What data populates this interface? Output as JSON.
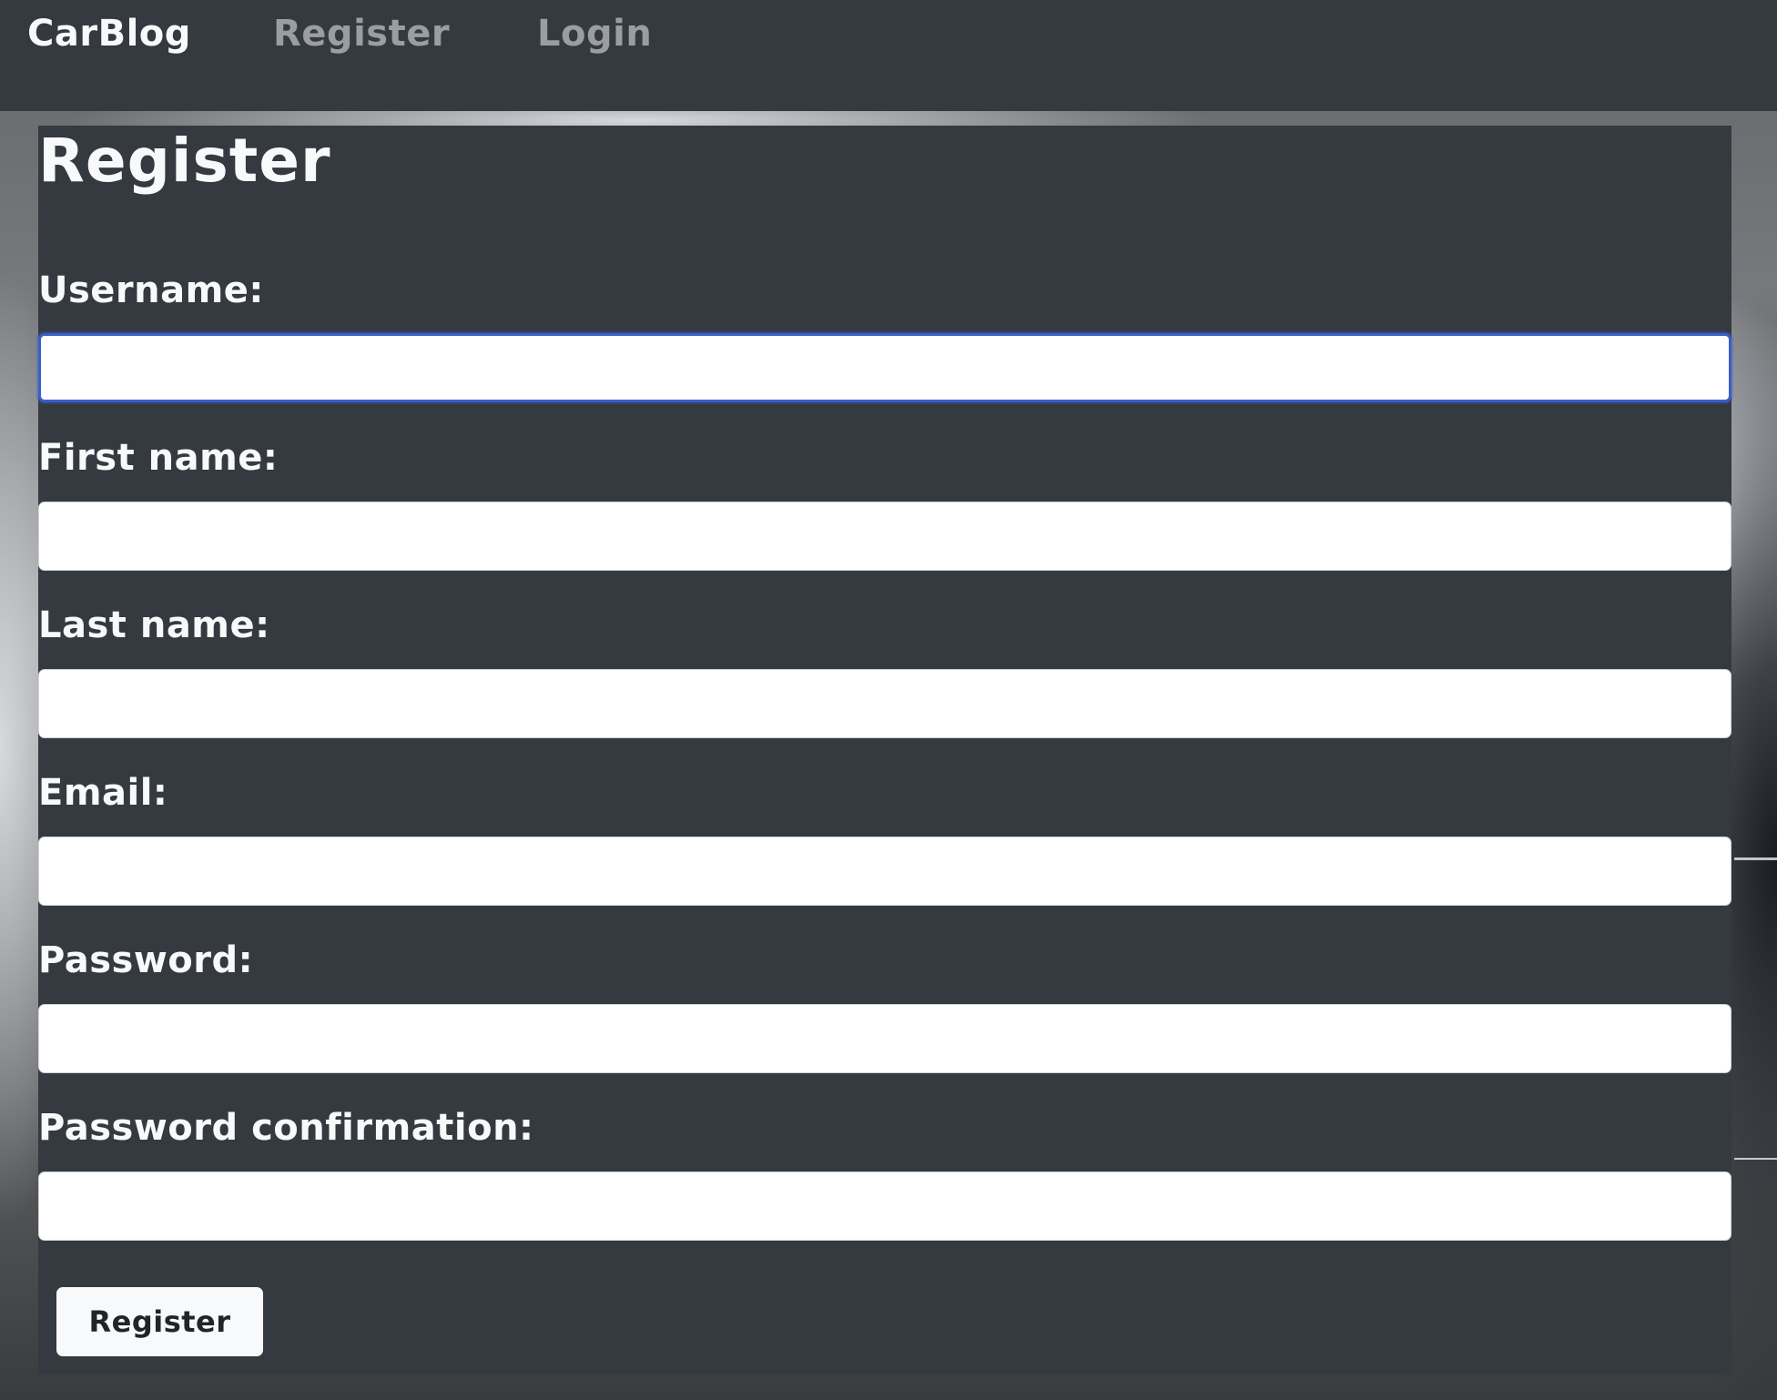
{
  "navbar": {
    "brand": "CarBlog",
    "links": [
      {
        "label": "Register"
      },
      {
        "label": "Login"
      }
    ]
  },
  "form": {
    "title": "Register",
    "fields": [
      {
        "label": "Username:",
        "value": "",
        "focused": true
      },
      {
        "label": "First name:",
        "value": ""
      },
      {
        "label": "Last name:",
        "value": ""
      },
      {
        "label": "Email:",
        "value": ""
      },
      {
        "label": "Password:",
        "value": ""
      },
      {
        "label": "Password confirmation:",
        "value": ""
      }
    ],
    "submit_label": "Register"
  },
  "colors": {
    "navbar_bg": "#343a40",
    "card_bg": "#343a40",
    "text_light": "#f8f9fa",
    "link_muted": "#9a9da1",
    "focus_border": "#3b5fc9"
  }
}
